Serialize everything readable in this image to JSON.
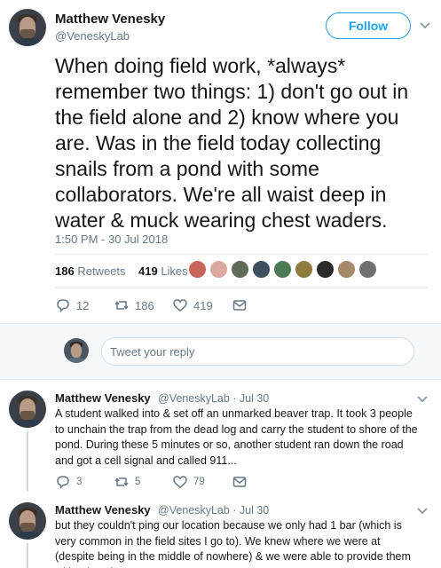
{
  "tweet": {
    "author_name": "Matthew Venesky",
    "author_handle": "@VeneskyLab",
    "follow_label": "Follow",
    "text": "When doing field work, *always* remember two things: 1) don't go out in the field alone and 2) know where you are. Was in the field today collecting snails from a pond with some collaborators. We're all waist deep in water & muck wearing chest waders.",
    "timestamp": "1:50 PM - 30 Jul 2018",
    "retweets_count": "186",
    "retweets_label": "Retweets",
    "likes_count": "419",
    "likes_label": "Likes",
    "actions": {
      "replies": "12",
      "retweets": "186",
      "likes": "419"
    }
  },
  "reply_box": {
    "placeholder": "Tweet your reply"
  },
  "replies": [
    {
      "author_name": "Matthew Venesky",
      "meta": "@VeneskyLab · Jul 30",
      "text": "A student walked into & set off an unmarked beaver trap. It took 3 people to unchain the trap from the dead log and carry the student to shore of the pond. During these 5 minutes or so, another student ran down the road and got a cell signal and called 911...",
      "actions": {
        "replies": "3",
        "retweets": "5",
        "likes": "79"
      }
    },
    {
      "author_name": "Matthew Venesky",
      "meta": "@VeneskyLab · Jul 30",
      "text": "but they couldn't ping our location because we only had 1 bar (which is very common in the field sites I go to). We knew where we were at (despite being in the middle of nowhere) & we were able to provide them with a location."
    }
  ],
  "colors": {
    "accent": "#1da1f2",
    "muted": "#657786",
    "divider": "#e6ecf0"
  },
  "icons": [
    "chevron-down-icon",
    "reply-icon",
    "retweet-icon",
    "like-icon",
    "message-icon"
  ]
}
